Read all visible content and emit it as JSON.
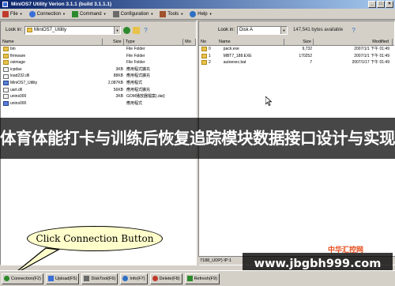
{
  "window": {
    "title": "MiniOS7 Utility Verion 3.1.1 (build 3.1.1.1)"
  },
  "menu": [
    {
      "label": "File",
      "icon": "file-icon",
      "color": "#c0392b"
    },
    {
      "label": "Connection",
      "icon": "connection-icon",
      "color": "#3a6ed8"
    },
    {
      "label": "Command",
      "icon": "command-icon",
      "color": "#2c8a2c"
    },
    {
      "label": "Configuration",
      "icon": "configuration-icon",
      "color": "#6a6a6a"
    },
    {
      "label": "Tools",
      "icon": "tools-icon",
      "color": "#a0522d"
    },
    {
      "label": "Help",
      "icon": "help-icon",
      "color": "#2d6fc4"
    }
  ],
  "left": {
    "look_in_label": "Look in:",
    "look_in_value": "MiniOS7_Utility",
    "columns": [
      "Name",
      "Size",
      "Type",
      "Mo"
    ],
    "files": [
      {
        "name": "bin",
        "size": "",
        "type": "File Folder",
        "icon": "folder-icon"
      },
      {
        "name": "firmware",
        "size": "",
        "type": "File Folder",
        "icon": "folder-icon"
      },
      {
        "name": "osimage",
        "size": "",
        "type": "File Folder",
        "icon": "folder-icon"
      },
      {
        "name": "icpdas",
        "size": "3KB",
        "type": "應用程式擴充",
        "icon": "file-icon"
      },
      {
        "name": "load232.dll",
        "size": "88KB",
        "type": "應用程式擴充",
        "icon": "file-icon"
      },
      {
        "name": "MiniOS7_Utility",
        "size": "2,087KB",
        "type": "應用程式",
        "icon": "exe-icon"
      },
      {
        "name": "uart.dll",
        "size": "56KB",
        "type": "應用程式擴充",
        "icon": "file-icon"
      },
      {
        "name": "unins000",
        "size": "3KB",
        "type": "GOM播放器檔案(.dat)",
        "icon": "file-icon"
      },
      {
        "name": "unins000",
        "size": "",
        "type": "應用程式",
        "icon": "exe-icon"
      }
    ]
  },
  "right": {
    "look_in_label": "Look in:",
    "look_in_value": "Disk A",
    "free_text": "147,541 bytes available",
    "columns": [
      "No",
      "Name",
      "Size",
      "Modified"
    ],
    "files": [
      {
        "no": "0",
        "name": "pack.exe",
        "size": "9,732",
        "modified": "2007/1/1 下午 01:49"
      },
      {
        "no": "1",
        "name": "MBT7_188.EXE",
        "size": "170252",
        "modified": "2007/1/1 下午 01:49"
      },
      {
        "no": "2",
        "name": "autoexec.bat",
        "size": "7",
        "modified": "2007/1/17 下午 01:49"
      }
    ],
    "status": "7188_UDP) IP:1"
  },
  "banner": "体育体能打卡与训练后恢复追踪模块数据接口设计与实现",
  "callout": "Click Connection Button",
  "watermark": {
    "text": "www.jbgbh999.com",
    "logo": "中华汇控网"
  },
  "bottom_buttons": [
    {
      "label": "Connection(F2)",
      "icon": "connection-icon",
      "color": "#2c8a2c"
    },
    {
      "label": "Upload(F5)",
      "icon": "upload-icon",
      "color": "#3a6ed8"
    },
    {
      "label": "DiskTool(F6)",
      "icon": "disk-tool-icon",
      "color": "#6a6a6a"
    },
    {
      "label": "Info(F7)",
      "icon": "info-icon",
      "color": "#2d6fc4"
    },
    {
      "label": "Delete(F8)",
      "icon": "delete-icon",
      "color": "#c0392b"
    },
    {
      "label": "Refresh(F9)",
      "icon": "refresh-icon",
      "color": "#2c8a2c"
    }
  ]
}
